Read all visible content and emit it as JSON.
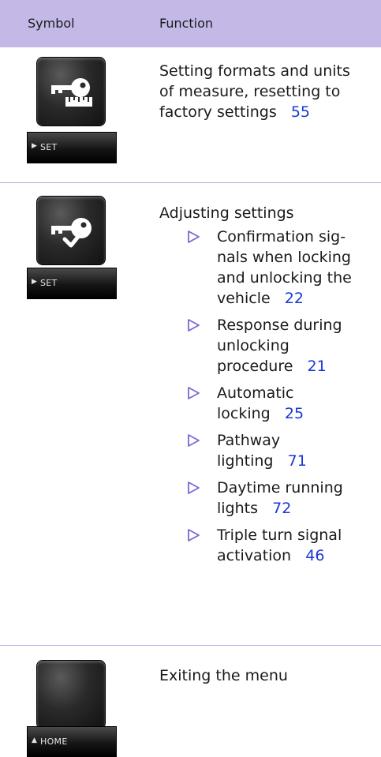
{
  "header": {
    "symbol": "Symbol",
    "function": "Function"
  },
  "rows": [
    {
      "pill_label": "SET",
      "lines": [
        "Setting formats and units",
        "of measure, resetting to",
        "factory settings"
      ],
      "ref": "55"
    },
    {
      "pill_label": "SET",
      "title": "Adjusting settings",
      "items": [
        {
          "lines": [
            "Confirmation sig-",
            "nals when locking",
            "and unlocking the",
            "vehicle"
          ],
          "ref": "22"
        },
        {
          "lines": [
            "Response during",
            "unlocking",
            "procedure"
          ],
          "ref": "21"
        },
        {
          "lines": [
            "Automatic",
            "locking"
          ],
          "ref": "25"
        },
        {
          "lines": [
            "Pathway",
            "lighting"
          ],
          "ref": "71"
        },
        {
          "lines": [
            "Daytime running",
            "lights"
          ],
          "ref": "72"
        },
        {
          "lines": [
            "Triple turn signal",
            "activation"
          ],
          "ref": "46"
        }
      ]
    },
    {
      "pill_label": "HOME",
      "title": "Exiting the menu"
    }
  ],
  "colors": {
    "header_bg": "#c4b9e6",
    "divider": "#b3a8e0",
    "link": "#1a37d6",
    "bullet": "#7a68d6"
  },
  "icons": [
    "key-ruler-icon",
    "key-check-icon",
    "blank-button-icon",
    "play-arrow-icon",
    "up-arrow-icon",
    "triangle-bullet-icon"
  ]
}
